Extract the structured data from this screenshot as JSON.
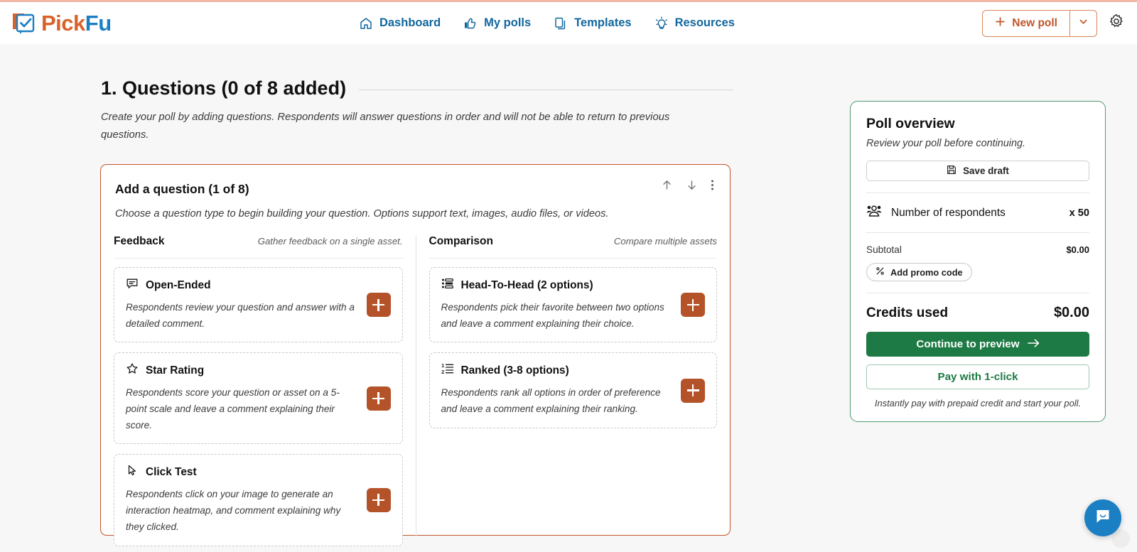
{
  "brand": {
    "name_pick": "Pick",
    "name_fu": "Fu",
    "accent_orange": "#c1562a",
    "accent_blue": "#11679e",
    "accent_green": "#1d7a44",
    "plus_button_color": "#b4532a"
  },
  "nav": {
    "items": [
      {
        "label": "Dashboard",
        "icon": "home-icon"
      },
      {
        "label": "My polls",
        "icon": "thumbs-up-icon"
      },
      {
        "label": "Templates",
        "icon": "copy-icon"
      },
      {
        "label": "Resources",
        "icon": "lightbulb-icon"
      }
    ],
    "new_poll_label": "New poll",
    "new_poll_icon": "plus-icon",
    "new_poll_caret_icon": "chevron-down-icon",
    "settings_icon": "gear-icon"
  },
  "section": {
    "title": "1. Questions (0 of 8 added)",
    "description": "Create your poll by adding questions. Respondents will answer questions in order and will not be able to return to previous questions."
  },
  "question_card": {
    "title": "Add a question (1 of 8)",
    "description": "Choose a question type to begin building your question. Options support text, images, audio files, or videos.",
    "actions": [
      {
        "name": "move-up",
        "icon": "arrow-up-icon"
      },
      {
        "name": "move-down",
        "icon": "arrow-down-icon"
      },
      {
        "name": "more-options",
        "icon": "kebab-menu-icon"
      }
    ],
    "columns": [
      {
        "heading": "Feedback",
        "subheading": "Gather feedback on a single asset.",
        "options": [
          {
            "title": "Open-Ended",
            "icon": "speech-bubble-icon",
            "description": "Respondents review your question and answer with a detailed comment.",
            "add_icon": "plus-icon"
          },
          {
            "title": "Star Rating",
            "icon": "star-icon",
            "description": "Respondents score your question or asset on a 5-point scale and leave a comment explaining their score.",
            "add_icon": "plus-icon"
          },
          {
            "title": "Click Test",
            "icon": "cursor-icon",
            "description": "Respondents click on your image to generate an interaction heatmap, and comment explaining why they clicked.",
            "add_icon": "plus-icon"
          }
        ]
      },
      {
        "heading": "Comparison",
        "subheading": "Compare multiple assets",
        "options": [
          {
            "title": "Head-To-Head (2 options)",
            "icon": "bar-list-icon",
            "description": "Respondents pick their favorite between two options and leave a comment explaining their choice.",
            "add_icon": "plus-icon"
          },
          {
            "title": "Ranked (3-8 options)",
            "icon": "numbered-list-icon",
            "description": "Respondents rank all options in order of preference and leave a comment explaining their ranking.",
            "add_icon": "plus-icon"
          }
        ]
      }
    ]
  },
  "sidebar": {
    "title": "Poll overview",
    "subtitle": "Review your poll before continuing.",
    "save_draft_label": "Save draft",
    "save_draft_icon": "floppy-disk-icon",
    "respondents_label": "Number of respondents",
    "respondents_icon": "people-icon",
    "respondents_value": "x 50",
    "subtotal_label": "Subtotal",
    "subtotal_value": "$0.00",
    "promo_label": "Add promo code",
    "promo_icon": "percent-icon",
    "credits_label": "Credits used",
    "credits_value": "$0.00",
    "continue_label": "Continue to preview",
    "continue_icon": "arrow-right-icon",
    "pay_label": "Pay with 1-click",
    "note": "Instantly pay with prepaid credit and start your poll."
  },
  "chat": {
    "icon": "chat-bubble-icon"
  }
}
